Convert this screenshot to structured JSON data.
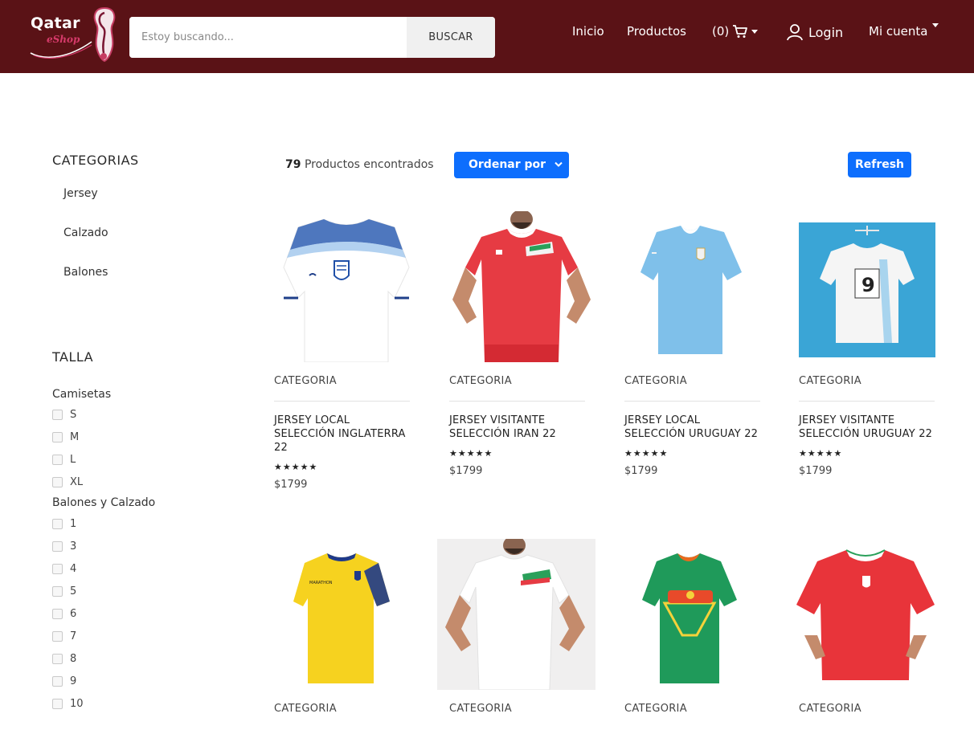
{
  "brand": {
    "logo_line1": "Qatar",
    "logo_line2": "eShop",
    "colors": {
      "header_bg": "#5a1216",
      "accent": "#0d6efd",
      "logo_pink": "#d63a6a"
    }
  },
  "search": {
    "placeholder": "Estoy buscando...",
    "button_label": "BUSCAR"
  },
  "nav": {
    "inicio": "Inicio",
    "productos": "Productos",
    "cart_count": "(0)",
    "login": "Login",
    "cuenta": "Mi cuenta"
  },
  "sidebar": {
    "categories_title": "CATEGORIAS",
    "categories": [
      "Jersey",
      "Calzado",
      "Balones"
    ],
    "size_title": "TALLA",
    "shirts_title": "Camisetas",
    "shirt_sizes": [
      "S",
      "M",
      "L",
      "XL"
    ],
    "balls_title": "Balones y Calzado",
    "ball_sizes": [
      "1",
      "3",
      "4",
      "5",
      "6",
      "7",
      "8",
      "9",
      "10"
    ]
  },
  "toolbar": {
    "count_number": "79",
    "count_label": "Productos encontrados",
    "sort_label": "Ordenar por",
    "refresh_label": "Refresh"
  },
  "products": [
    {
      "category": "CATEGORIA",
      "name": "JERSEY LOCAL SELECCIÓN INGLATERRA 22",
      "stars": "★★★★★",
      "price": "$1799",
      "icon": "england-home-jersey"
    },
    {
      "category": "CATEGORIA",
      "name": "JERSEY VISITANTE SELECCIÓN IRAN 22",
      "stars": "★★★★★",
      "price": "$1799",
      "icon": "iran-away-jersey"
    },
    {
      "category": "CATEGORIA",
      "name": "JERSEY LOCAL SELECCIÓN URUGUAY 22",
      "stars": "★★★★★",
      "price": "$1799",
      "icon": "uruguay-home-jersey"
    },
    {
      "category": "CATEGORIA",
      "name": "JERSEY VISITANTE SELECCIÓN URUGUAY 22",
      "stars": "★★★★★",
      "price": "$1799",
      "icon": "uruguay-away-jersey"
    },
    {
      "category": "CATEGORIA",
      "icon": "ecuador-jersey"
    },
    {
      "category": "CATEGORIA",
      "icon": "iran-home-jersey"
    },
    {
      "category": "CATEGORIA",
      "icon": "senegal-jersey"
    },
    {
      "category": "CATEGORIA",
      "icon": "wales-jersey"
    }
  ]
}
